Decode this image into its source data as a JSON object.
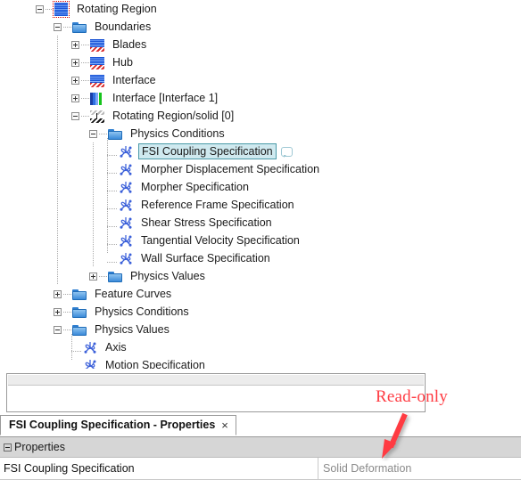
{
  "tree": {
    "name": "simulation-object-tree",
    "nodes": [
      {
        "label": "Rotating Region",
        "icon": "rotating-region-icon",
        "depth": 0,
        "toggle": "minus",
        "selected_outline": true
      },
      {
        "label": "Boundaries",
        "icon": "folder-icon",
        "depth": 1,
        "toggle": "minus"
      },
      {
        "label": "Blades",
        "icon": "boundary-icon",
        "depth": 2,
        "toggle": "plus"
      },
      {
        "label": "Hub",
        "icon": "boundary-icon",
        "depth": 2,
        "toggle": "plus"
      },
      {
        "label": "Interface",
        "icon": "boundary-icon",
        "depth": 2,
        "toggle": "plus"
      },
      {
        "label": "Interface [Interface 1]",
        "icon": "interface-icon",
        "depth": 2,
        "toggle": "plus"
      },
      {
        "label": "Rotating Region/solid [0]",
        "icon": "solid-boundary-icon",
        "depth": 2,
        "toggle": "minus"
      },
      {
        "label": "Physics Conditions",
        "icon": "folder-icon",
        "depth": 3,
        "toggle": "minus"
      },
      {
        "label": "FSI Coupling Specification",
        "icon": "specification-icon",
        "depth": 4,
        "toggle": "leaf",
        "selected": true,
        "comment": true
      },
      {
        "label": "Morpher Displacement Specification",
        "icon": "specification-icon",
        "depth": 4,
        "toggle": "leaf"
      },
      {
        "label": "Morpher Specification",
        "icon": "specification-icon",
        "depth": 4,
        "toggle": "leaf"
      },
      {
        "label": "Reference Frame Specification",
        "icon": "specification-icon",
        "depth": 4,
        "toggle": "leaf"
      },
      {
        "label": "Shear Stress Specification",
        "icon": "specification-icon",
        "depth": 4,
        "toggle": "leaf"
      },
      {
        "label": "Tangential Velocity Specification",
        "icon": "specification-icon",
        "depth": 4,
        "toggle": "leaf"
      },
      {
        "label": "Wall Surface Specification",
        "icon": "specification-icon",
        "depth": 4,
        "toggle": "leaf",
        "last": true
      },
      {
        "label": "Physics Values",
        "icon": "folder-icon",
        "depth": 3,
        "toggle": "plus"
      },
      {
        "label": "Feature Curves",
        "icon": "folder-icon",
        "depth": 1,
        "toggle": "plus"
      },
      {
        "label": "Physics Conditions",
        "icon": "folder-icon",
        "depth": 1,
        "toggle": "plus"
      },
      {
        "label": "Physics Values",
        "icon": "folder-icon",
        "depth": 1,
        "toggle": "minus"
      },
      {
        "label": "Axis",
        "icon": "specification-icon",
        "depth": 2,
        "toggle": "leaf"
      },
      {
        "label": "Motion Specification",
        "icon": "specification-icon",
        "depth": 2,
        "toggle": "leaf",
        "last": true
      }
    ]
  },
  "properties_panel": {
    "tab_title": "FSI Coupling Specification - Properties",
    "close_label": "×",
    "group_label": "Properties",
    "rows": [
      {
        "name": "FSI Coupling Specification",
        "value": "Solid Deformation"
      }
    ]
  },
  "annotation": {
    "text": "Read-only",
    "color": "#ff3b42"
  }
}
